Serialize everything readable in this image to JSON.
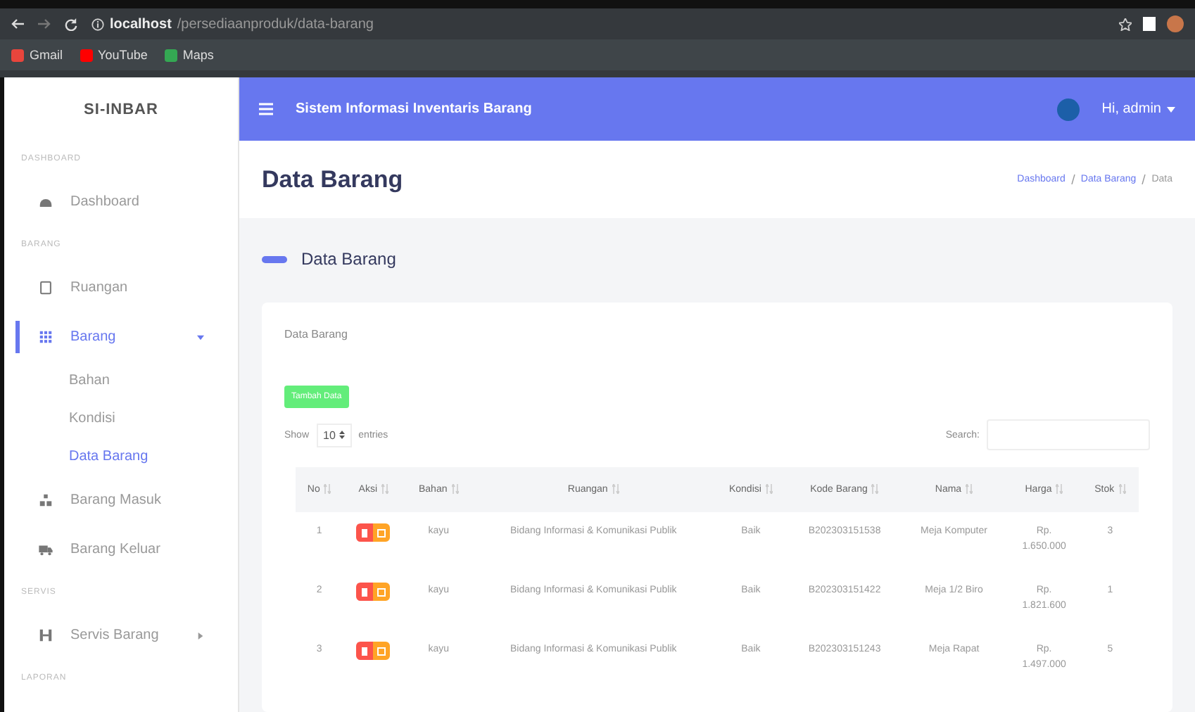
{
  "browser": {
    "url_host": "localhost",
    "url_path": "/persediaanproduk/data-barang",
    "bookmarks": [
      "Gmail",
      "YouTube",
      "Maps"
    ]
  },
  "sidebar": {
    "brand": "SI-INBAR",
    "items": [
      {
        "kind": "heading",
        "label": "DASHBOARD"
      },
      {
        "kind": "link",
        "label": "Dashboard",
        "selected": false
      },
      {
        "kind": "heading",
        "label": "BARANG"
      },
      {
        "kind": "link",
        "label": "Ruangan",
        "selected": false
      },
      {
        "kind": "group",
        "label": "Barang",
        "selected": true,
        "expanded": true,
        "children": [
          {
            "label": "Bahan",
            "selected": false
          },
          {
            "label": "Kondisi",
            "selected": false
          },
          {
            "label": "Data Barang",
            "selected": true
          }
        ]
      },
      {
        "kind": "link",
        "label": "Barang Masuk",
        "selected": false
      },
      {
        "kind": "link",
        "label": "Barang Keluar",
        "selected": false
      },
      {
        "kind": "heading",
        "label": "SERVIS"
      },
      {
        "kind": "group",
        "label": "Servis Barang",
        "selected": false,
        "expanded": false
      },
      {
        "kind": "heading",
        "label": "LAPORAN"
      }
    ]
  },
  "topbar": {
    "title": "Sistem Informasi Inventaris Barang",
    "user": "Hi, admin"
  },
  "page": {
    "title": "Data Barang",
    "breadcrumbs": [
      "Dashboard",
      "Data Barang",
      "Data"
    ],
    "section_title": "Data Barang"
  },
  "card": {
    "title": "Data Barang",
    "add_button": "Tambah Data",
    "show_label": "Show",
    "entries_value": "10",
    "entries_label": "entries",
    "search_label": "Search:",
    "table": {
      "columns": [
        "No",
        "Aksi",
        "Bahan",
        "Ruangan",
        "Kondisi",
        "Kode Barang",
        "Nama",
        "Harga",
        "Stok"
      ],
      "rows": [
        {
          "no": "1",
          "bahan": "kayu",
          "ruangan": "Bidang Informasi & Komunikasi Publik",
          "kondisi": "Baik",
          "kode": "B202303151538",
          "nama": "Meja Komputer",
          "harga": [
            "Rp.",
            "1.650.000"
          ],
          "stok": "3"
        },
        {
          "no": "2",
          "bahan": "kayu",
          "ruangan": "Bidang Informasi & Komunikasi Publik",
          "kondisi": "Baik",
          "kode": "B202303151422",
          "nama": "Meja 1/2 Biro",
          "harga": [
            "Rp.",
            "1.821.600"
          ],
          "stok": "1"
        },
        {
          "no": "3",
          "bahan": "kayu",
          "ruangan": "Bidang Informasi & Komunikasi Publik",
          "kondisi": "Baik",
          "kode": "B202303151243",
          "nama": "Meja Rapat",
          "harga": [
            "Rp.",
            "1.497.000"
          ],
          "stok": "5"
        }
      ]
    }
  }
}
